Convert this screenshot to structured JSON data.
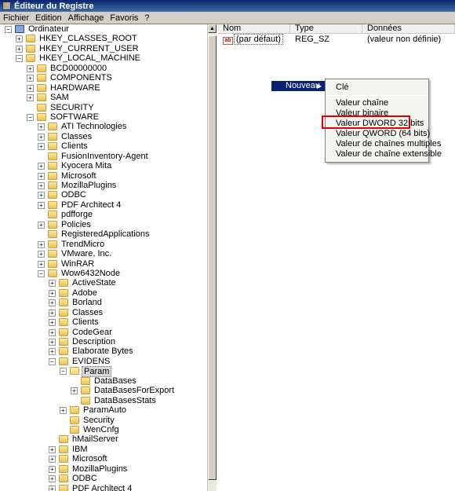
{
  "window": {
    "title": "Éditeur du Registre"
  },
  "menubar": [
    "Fichier",
    "Edition",
    "Affichage",
    "Favoris",
    "?"
  ],
  "tree": [
    {
      "label": "Ordinateur",
      "level": 0,
      "expander": "-",
      "icon": "computer"
    },
    {
      "label": "HKEY_CLASSES_ROOT",
      "level": 1,
      "expander": "+"
    },
    {
      "label": "HKEY_CURRENT_USER",
      "level": 1,
      "expander": "+"
    },
    {
      "label": "HKEY_LOCAL_MACHINE",
      "level": 1,
      "expander": "-"
    },
    {
      "label": "BCD00000000",
      "level": 2,
      "expander": "+"
    },
    {
      "label": "COMPONENTS",
      "level": 2,
      "expander": "+"
    },
    {
      "label": "HARDWARE",
      "level": 2,
      "expander": "+"
    },
    {
      "label": "SAM",
      "level": 2,
      "expander": "+"
    },
    {
      "label": "SECURITY",
      "level": 2,
      "expander": ""
    },
    {
      "label": "SOFTWARE",
      "level": 2,
      "expander": "-"
    },
    {
      "label": "ATI Technologies",
      "level": 3,
      "expander": "+"
    },
    {
      "label": "Classes",
      "level": 3,
      "expander": "+"
    },
    {
      "label": "Clients",
      "level": 3,
      "expander": "+"
    },
    {
      "label": "FusionInventory-Agent",
      "level": 3,
      "expander": ""
    },
    {
      "label": "Kyocera Mita",
      "level": 3,
      "expander": "+"
    },
    {
      "label": "Microsoft",
      "level": 3,
      "expander": "+"
    },
    {
      "label": "MozillaPlugins",
      "level": 3,
      "expander": "+"
    },
    {
      "label": "ODBC",
      "level": 3,
      "expander": "+"
    },
    {
      "label": "PDF Architect 4",
      "level": 3,
      "expander": "+"
    },
    {
      "label": "pdfforge",
      "level": 3,
      "expander": ""
    },
    {
      "label": "Policies",
      "level": 3,
      "expander": "+"
    },
    {
      "label": "RegisteredApplications",
      "level": 3,
      "expander": ""
    },
    {
      "label": "TrendMicro",
      "level": 3,
      "expander": "+"
    },
    {
      "label": "VMware, Inc.",
      "level": 3,
      "expander": "+"
    },
    {
      "label": "WinRAR",
      "level": 3,
      "expander": "+"
    },
    {
      "label": "Wow6432Node",
      "level": 3,
      "expander": "-"
    },
    {
      "label": "ActiveState",
      "level": 4,
      "expander": "+"
    },
    {
      "label": "Adobe",
      "level": 4,
      "expander": "+"
    },
    {
      "label": "Borland",
      "level": 4,
      "expander": "+"
    },
    {
      "label": "Classes",
      "level": 4,
      "expander": "+"
    },
    {
      "label": "Clients",
      "level": 4,
      "expander": "+"
    },
    {
      "label": "CodeGear",
      "level": 4,
      "expander": "+"
    },
    {
      "label": "Description",
      "level": 4,
      "expander": "+"
    },
    {
      "label": "Elaborate Bytes",
      "level": 4,
      "expander": "+"
    },
    {
      "label": "EVIDENS",
      "level": 4,
      "expander": "-"
    },
    {
      "label": "Param",
      "level": 5,
      "expander": "-",
      "selected": true,
      "open": true
    },
    {
      "label": "DataBases",
      "level": 6,
      "expander": ""
    },
    {
      "label": "DataBasesForExport",
      "level": 6,
      "expander": "+"
    },
    {
      "label": "DataBasesStats",
      "level": 6,
      "expander": ""
    },
    {
      "label": "ParamAuto",
      "level": 5,
      "expander": "+"
    },
    {
      "label": "Security",
      "level": 5,
      "expander": ""
    },
    {
      "label": "WenCnfg",
      "level": 5,
      "expander": ""
    },
    {
      "label": "hMailServer",
      "level": 4,
      "expander": ""
    },
    {
      "label": "IBM",
      "level": 4,
      "expander": "+"
    },
    {
      "label": "Microsoft",
      "level": 4,
      "expander": "+"
    },
    {
      "label": "MozillaPlugins",
      "level": 4,
      "expander": "+"
    },
    {
      "label": "ODBC",
      "level": 4,
      "expander": "+"
    },
    {
      "label": "PDF Architect 4",
      "level": 4,
      "expander": "+"
    }
  ],
  "list": {
    "columns": [
      "Nom",
      "Type",
      "Données"
    ],
    "rows": [
      {
        "icon": "ab",
        "name": "(par défaut)",
        "type": "REG_SZ",
        "data": "(valeur non définie)"
      }
    ]
  },
  "context_menu": {
    "parent_label": "Nouveau",
    "items": [
      {
        "label": "Clé",
        "separator_after": true
      },
      {
        "label": "Valeur chaîne"
      },
      {
        "label": "Valeur binaire"
      },
      {
        "label": "Valeur DWORD 32 bits",
        "highlighted": true
      },
      {
        "label": "Valeur QWORD (64 bits)"
      },
      {
        "label": "Valeur de chaînes multiples"
      },
      {
        "label": "Valeur de chaîne extensible"
      }
    ]
  }
}
